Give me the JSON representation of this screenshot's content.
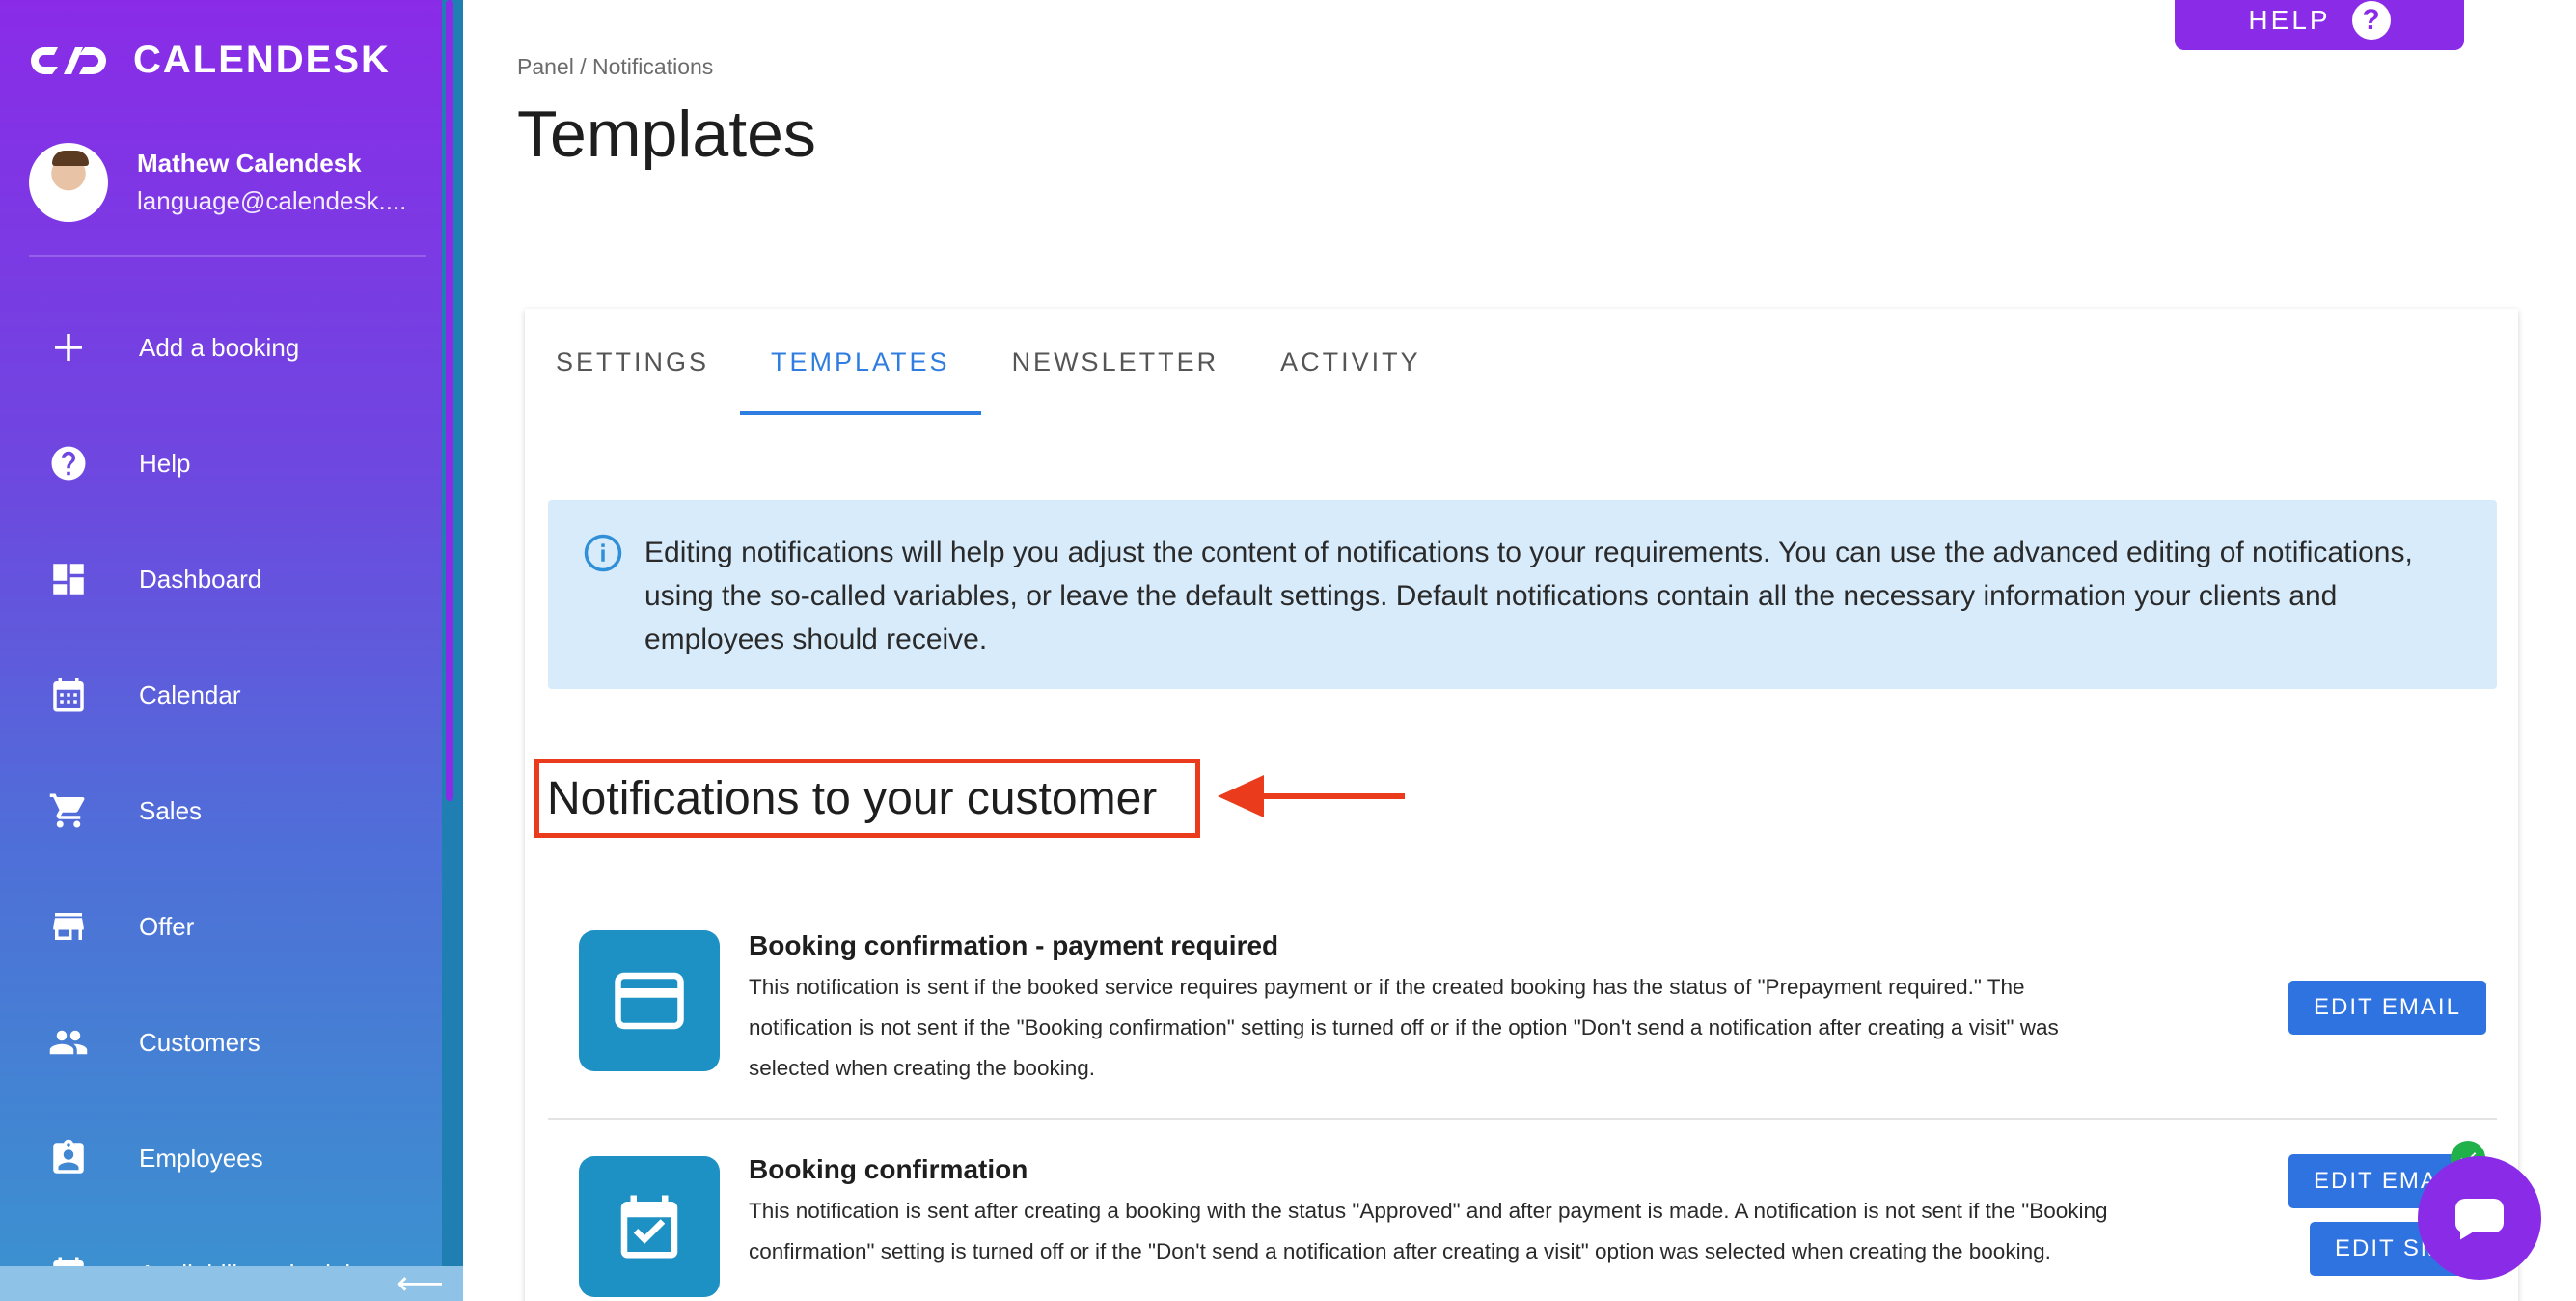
{
  "brand": {
    "name": "CALENDESK",
    "logo_icon": "calendesk-logo-icon",
    "primary_color": "#8a2be8",
    "accent_color": "#2f73e0"
  },
  "user": {
    "name": "Mathew Calendesk",
    "email": "language@calendesk...."
  },
  "sidebar": {
    "items": [
      {
        "label": "Add a booking",
        "icon": "plus-icon"
      },
      {
        "label": "Help",
        "icon": "help-circle-icon"
      },
      {
        "label": "Dashboard",
        "icon": "dashboard-icon"
      },
      {
        "label": "Calendar",
        "icon": "calendar-icon"
      },
      {
        "label": "Sales",
        "icon": "cart-icon"
      },
      {
        "label": "Offer",
        "icon": "store-icon"
      },
      {
        "label": "Customers",
        "icon": "people-icon"
      },
      {
        "label": "Employees",
        "icon": "badge-icon"
      },
      {
        "label": "Availability schedules",
        "icon": "schedule-icon"
      }
    ],
    "collapse_icon": "arrow-left-icon"
  },
  "header": {
    "help_label": "HELP",
    "help_icon": "question-icon",
    "breadcrumb": "Panel / Notifications",
    "title": "Templates"
  },
  "tabs": [
    {
      "label": "SETTINGS",
      "active": false
    },
    {
      "label": "TEMPLATES",
      "active": true
    },
    {
      "label": "NEWSLETTER",
      "active": false
    },
    {
      "label": "ACTIVITY",
      "active": false
    }
  ],
  "info": {
    "icon": "info-icon",
    "text": "Editing notifications will help you adjust the content of notifications to your requirements. You can use the advanced editing of notifications, using the so-called variables, or leave the default settings. Default notifications contain all the necessary information your clients and employees should receive."
  },
  "section": {
    "heading": "Notifications to your customer",
    "highlight_color": "#ea3c1c"
  },
  "notifications": [
    {
      "title": "Booking confirmation - payment required",
      "description": "This notification is sent if the booked service requires payment or if the created booking has the status of \"Prepayment required.\" The notification is not sent if the \"Booking confirmation\" setting is turned off or if the option \"Don't send a notification after creating a visit\" was selected when creating the booking.",
      "icon": "credit-card-icon",
      "email_button": "EDIT EMAIL"
    },
    {
      "title": "Booking confirmation",
      "description": "This notification is sent after creating a booking with the status \"Approved\" and after payment is made. A notification is not sent if the \"Booking confirmation\" setting is turned off or if the \"Don't send a notification after creating a visit\" option was selected when creating the booking.",
      "icon": "calendar-check-icon",
      "email_button": "EDIT EMAIL",
      "sms_button": "EDIT SMS",
      "status_icon": "check-icon"
    }
  ],
  "chat": {
    "icon": "chat-bubble-icon"
  }
}
